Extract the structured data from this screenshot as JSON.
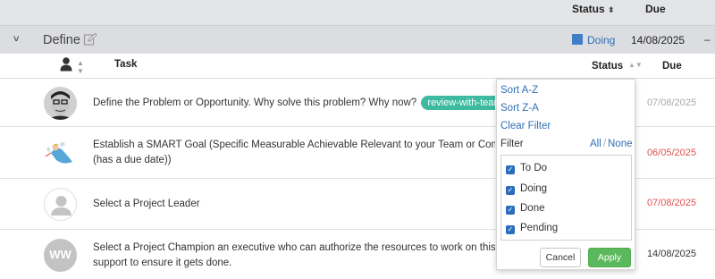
{
  "header": {
    "status_label": "Status",
    "status_sort": "⬍",
    "due_label": "Due"
  },
  "group": {
    "name": "Define",
    "status": "Doing",
    "status_color": "#3e7fc8",
    "due": "14/08/2025",
    "dash": "–",
    "collapse_icon": "chevron-down-icon",
    "edit_icon": "edit-icon"
  },
  "columns": {
    "task": "Task",
    "status": "Status",
    "due": "Due",
    "owner_icon": "person-icon"
  },
  "tasks": [
    {
      "text": "Define the Problem or Opportunity. Why solve this problem? Why now?",
      "tag": "review-with-team",
      "due": "07/08/2025",
      "due_color": "#aaaaaa"
    },
    {
      "text": "Establish a SMART Goal (Specific Measurable Achievable Relevant to your Team or Company",
      "text2": "(has a due date))",
      "due": "06/05/2025",
      "due_color": "#e05252"
    },
    {
      "text": "Select a Project Leader",
      "due": "07/08/2025",
      "due_color": "#e05252"
    },
    {
      "text": "Select a Project Champion an executive who can authorize the resources to work on this proje",
      "text2": "support to ensure it gets done.",
      "avatar_initials": "WW",
      "due": "14/08/2025",
      "due_color": "#333333"
    }
  ],
  "filter_popup": {
    "sort_az": "Sort A-Z",
    "sort_za": "Sort Z-A",
    "clear": "Clear Filter",
    "filter_label": "Filter",
    "all": "All",
    "separator": "/",
    "none": "None",
    "options": [
      {
        "label": "To Do",
        "checked": true
      },
      {
        "label": "Doing",
        "checked": true
      },
      {
        "label": "Done",
        "checked": true
      },
      {
        "label": "Pending",
        "checked": true
      }
    ],
    "cancel": "Cancel",
    "apply": "Apply"
  }
}
